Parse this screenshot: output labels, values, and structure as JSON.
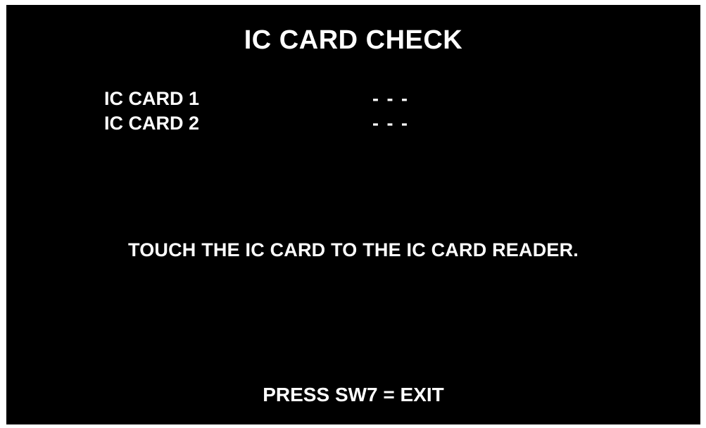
{
  "screen": {
    "title": "IC CARD CHECK",
    "cards": [
      {
        "label": "IC CARD 1",
        "status": "- - -"
      },
      {
        "label": "IC CARD 2",
        "status": "- - -"
      }
    ],
    "instruction": "TOUCH THE IC CARD TO THE IC CARD READER.",
    "exit_hint": "PRESS SW7 = EXIT"
  },
  "colors": {
    "background": "#000000",
    "text": "#ffffff",
    "frame": "#ffffff"
  }
}
